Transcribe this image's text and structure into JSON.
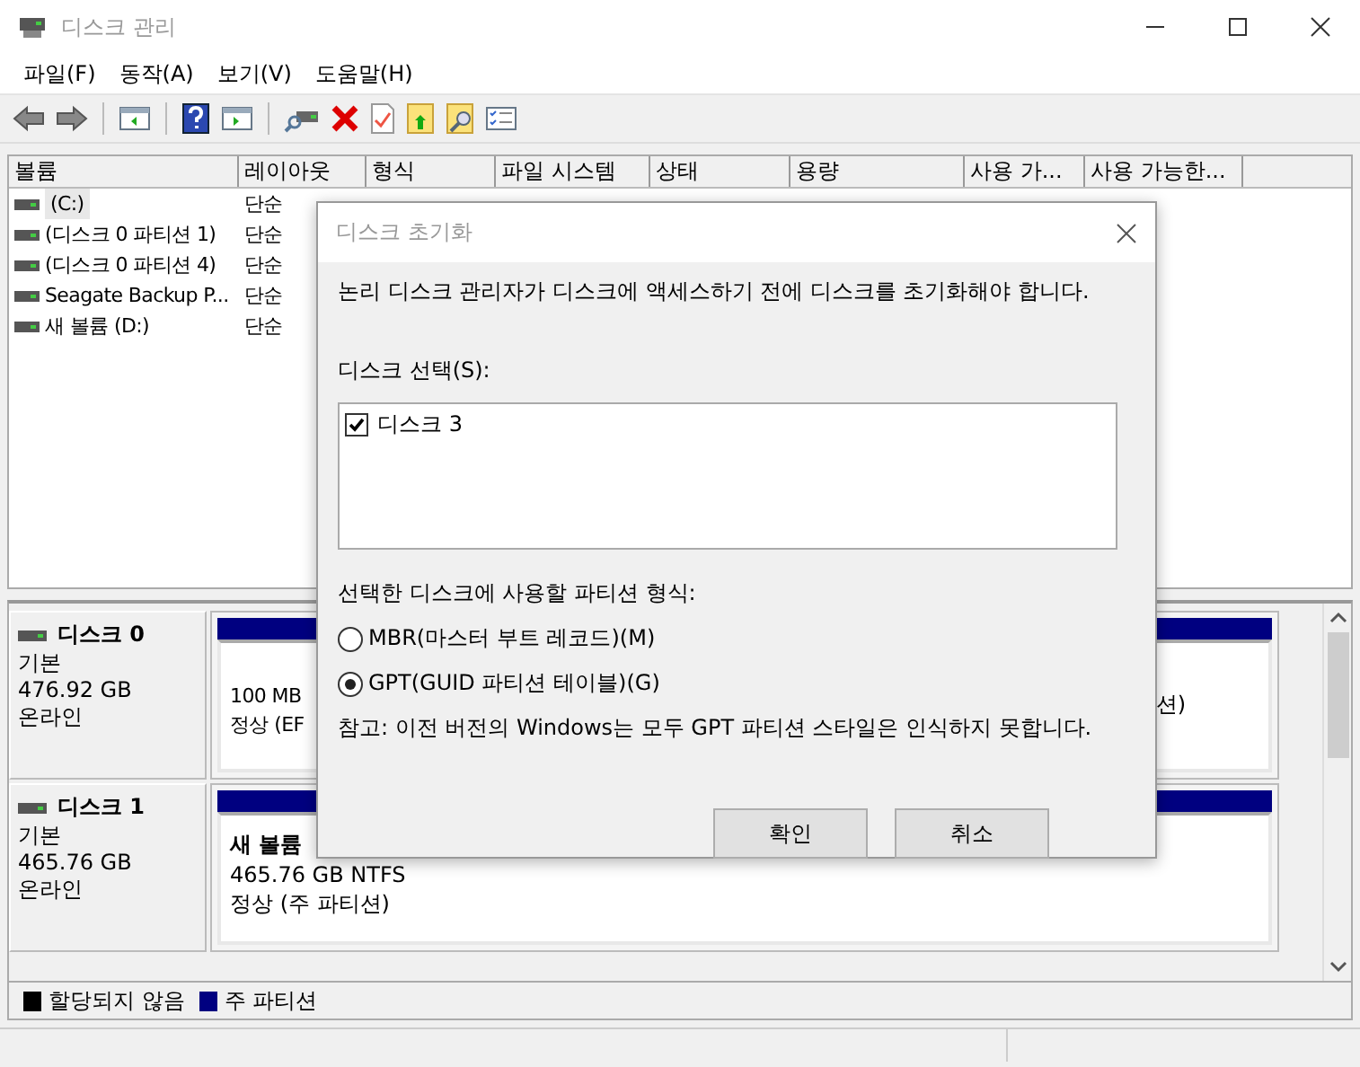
{
  "window": {
    "title": "디스크 관리"
  },
  "menu": [
    "파일(F)",
    "동작(A)",
    "보기(V)",
    "도움말(H)"
  ],
  "volume_table": {
    "columns": [
      "볼륨",
      "레이아웃",
      "형식",
      "파일 시스템",
      "상태",
      "용량",
      "사용 가...",
      "사용 가능한..."
    ],
    "rows": [
      {
        "cells": [
          "(C:)",
          "단순"
        ],
        "selected": true
      },
      {
        "cells": [
          "(디스크 0 파티션 1)",
          "단순"
        ],
        "selected": false
      },
      {
        "cells": [
          "(디스크 0 파티션 4)",
          "단순"
        ],
        "selected": false
      },
      {
        "cells": [
          "Seagate Backup P...",
          "단순"
        ],
        "selected": false
      },
      {
        "cells": [
          "새 볼륨 (D:)",
          "단순"
        ],
        "selected": false
      }
    ]
  },
  "disks": [
    {
      "name": "디스크 0",
      "type": "기본",
      "size": "476.92 GB",
      "status": "온라인",
      "partitions": [
        {
          "lines": [
            "100 MB",
            "정상 (EF"
          ]
        },
        {
          "lines": [
            "션)"
          ]
        }
      ]
    },
    {
      "name": "디스크 1",
      "type": "기본",
      "size": "465.76 GB",
      "status": "온라인",
      "partitions": [
        {
          "title": "새 볼륨",
          "lines": [
            "465.76 GB NTFS",
            "정상 (주 파티션)"
          ]
        }
      ]
    }
  ],
  "legend": [
    {
      "label": "할당되지 않음",
      "color": "#000000"
    },
    {
      "label": "주 파티션",
      "color": "#000080"
    }
  ],
  "dialog": {
    "title": "디스크 초기화",
    "message": "논리 디스크 관리자가 디스크에 액세스하기 전에 디스크를 초기화해야 합니다.",
    "disk_label": "디스크 선택(S):",
    "disks": [
      {
        "label": "디스크 3",
        "checked": true
      }
    ],
    "style_label": "선택한 디스크에 사용할 파티션 형식:",
    "styles": [
      {
        "label": "MBR(마스터 부트 레코드)(M)",
        "selected": false
      },
      {
        "label": "GPT(GUID 파티션 테이블)(G)",
        "selected": true
      }
    ],
    "note": "참고: 이전 버전의 Windows는 모두 GPT 파티션 스타일은 인식하지 못합니다.",
    "buttons": [
      "확인",
      "취소"
    ]
  }
}
